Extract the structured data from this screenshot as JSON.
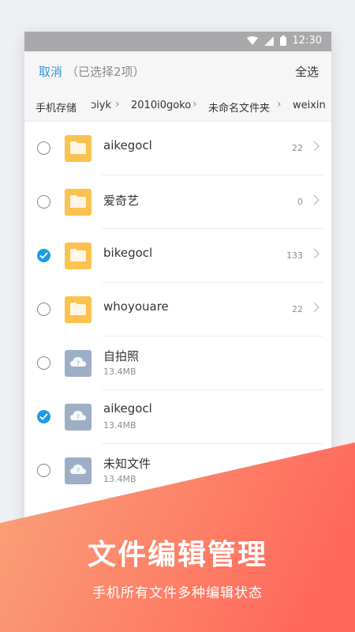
{
  "status_bar": {
    "time": "12:30"
  },
  "action_bar": {
    "cancel_label": "取消",
    "selected_info": "（已选择2项）",
    "select_all_label": "全选"
  },
  "breadcrumb": [
    "手机存储",
    "ɔiyk",
    "2010i0goko",
    "未命名文件夹",
    "weixin"
  ],
  "files": [
    {
      "name": "aikegocl",
      "type": "folder",
      "count": "22",
      "checked": false
    },
    {
      "name": "爱奇艺",
      "type": "folder",
      "count": "0",
      "checked": false
    },
    {
      "name": "bikegocl",
      "type": "folder",
      "count": "133",
      "checked": true
    },
    {
      "name": "whoyouare",
      "type": "folder",
      "count": "22",
      "checked": false
    },
    {
      "name": "自拍照",
      "type": "cloud-file",
      "size": "13.4MB",
      "checked": false
    },
    {
      "name": "aikegocl",
      "type": "cloud-file",
      "size": "13.4MB",
      "checked": true
    },
    {
      "name": "未知文件",
      "type": "cloud-file",
      "size": "13.4MB",
      "checked": false
    }
  ],
  "banner": {
    "title": "文件编辑管理",
    "subtitle": "手机所有文件多种编辑状态"
  },
  "colors": {
    "accent": "#1e9be6",
    "folder": "#fcc24f",
    "cloud_file": "#9eaec4",
    "banner_start": "#f9a37a",
    "banner_end": "#ff6a5c"
  }
}
